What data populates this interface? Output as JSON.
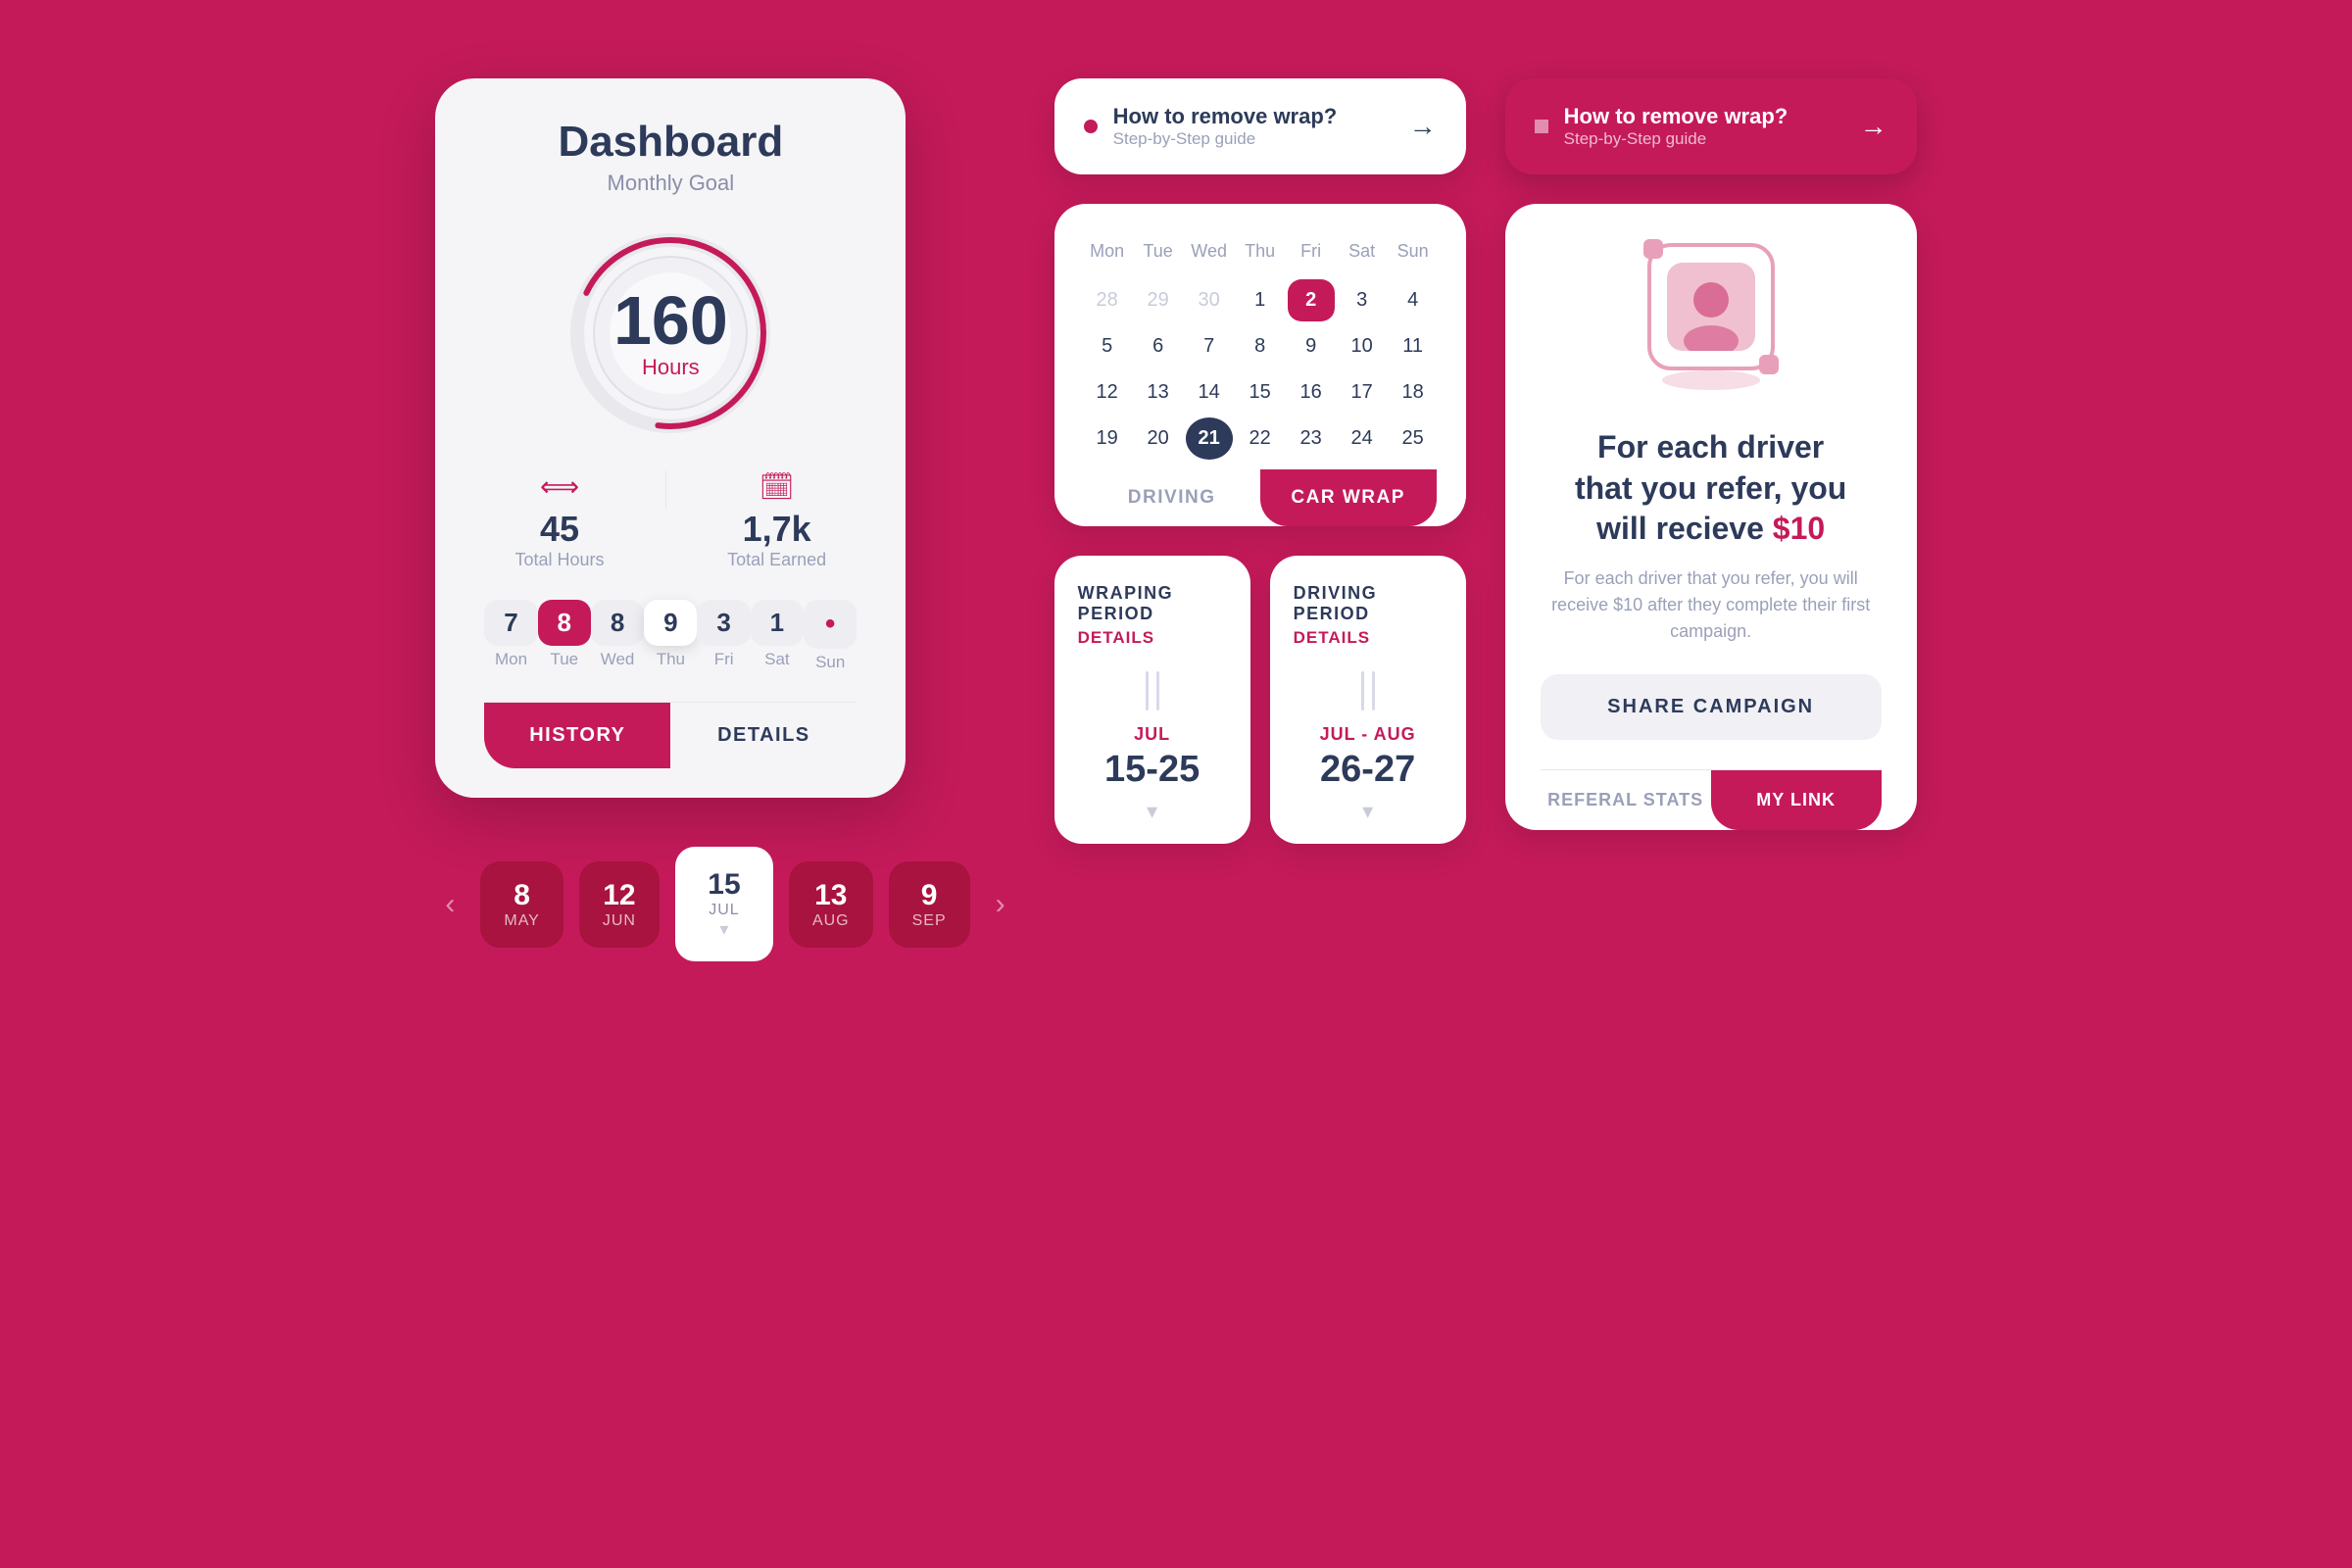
{
  "background_color": "#c41a5a",
  "dashboard": {
    "title": "Dashboard",
    "subtitle": "Monthly Goal",
    "gauge": {
      "value": "160",
      "label": "Hours",
      "progress": 75
    },
    "stats": {
      "total_hours_icon": "⟺",
      "total_hours": "45",
      "total_hours_label": "Total Hours",
      "total_earned": "1,7k",
      "total_earned_label": "Total Earned"
    },
    "days": [
      {
        "number": "7",
        "label": "Mon",
        "state": "normal"
      },
      {
        "number": "8",
        "label": "Tue",
        "state": "active"
      },
      {
        "number": "8",
        "label": "Wed",
        "state": "normal"
      },
      {
        "number": "9",
        "label": "Thu",
        "state": "today"
      },
      {
        "number": "3",
        "label": "Fri",
        "state": "normal"
      },
      {
        "number": "1",
        "label": "Sat",
        "state": "normal"
      },
      {
        "number": "•",
        "label": "Sun",
        "state": "dot"
      }
    ],
    "history_btn": "HISTORY",
    "details_btn": "DETAILS"
  },
  "month_scroller": {
    "left_arrow": "‹",
    "right_arrow": "›",
    "months": [
      {
        "num": "8",
        "name": "MAY",
        "active": false
      },
      {
        "num": "12",
        "name": "JUN",
        "active": false
      },
      {
        "num": "15",
        "name": "JUL",
        "active": true
      },
      {
        "num": "13",
        "name": "AUG",
        "active": false
      },
      {
        "num": "9",
        "name": "SEP",
        "active": false
      }
    ]
  },
  "info_banner_white": {
    "dot_color": "#c41a5a",
    "title": "How to remove wrap?",
    "subtitle": "Step-by-Step guide",
    "arrow": "→"
  },
  "info_banner_pink": {
    "dot_color": "white",
    "title": "How to remove wrap?",
    "subtitle": "Step-by-Step guide",
    "arrow": "→"
  },
  "calendar": {
    "headers": [
      "Mon",
      "Tue",
      "Wed",
      "Thu",
      "Fri",
      "Sat",
      "Sun"
    ],
    "weeks": [
      [
        "28",
        "29",
        "30",
        "1",
        "2",
        "3",
        "4"
      ],
      [
        "5",
        "6",
        "7",
        "8",
        "9",
        "10",
        "11"
      ],
      [
        "12",
        "13",
        "14",
        "15",
        "16",
        "17",
        "18"
      ],
      [
        "19",
        "20",
        "21",
        "22",
        "23",
        "24",
        "25"
      ]
    ],
    "inactive_prev": [
      "28",
      "29",
      "30"
    ],
    "today_date": "2",
    "selected_date": "21",
    "tabs": {
      "driving": "DRIVING",
      "car_wrap": "CAR WRAP"
    }
  },
  "wrapping_period": {
    "title": "WRAPING\nPERIOD",
    "details_link": "DETAILS",
    "month": "JUL",
    "dates": "15-25",
    "arrow_down": "▾"
  },
  "driving_period": {
    "title": "DRIVING\nPERIOD",
    "details_link": "DETAILS",
    "month": "JUL - AUG",
    "dates": "26-27",
    "arrow_down": "▾"
  },
  "referral": {
    "title_line1": "For each driver",
    "title_line2": "that you refer, you",
    "title_line3": "will recieve ",
    "amount": "$10",
    "description": "For each driver that you refer, you will receive $10 after they complete their first campaign.",
    "share_btn": "SHARE CAMPAIGN",
    "tab_stats": "REFERAL STATS",
    "tab_link": "MY LINK"
  }
}
